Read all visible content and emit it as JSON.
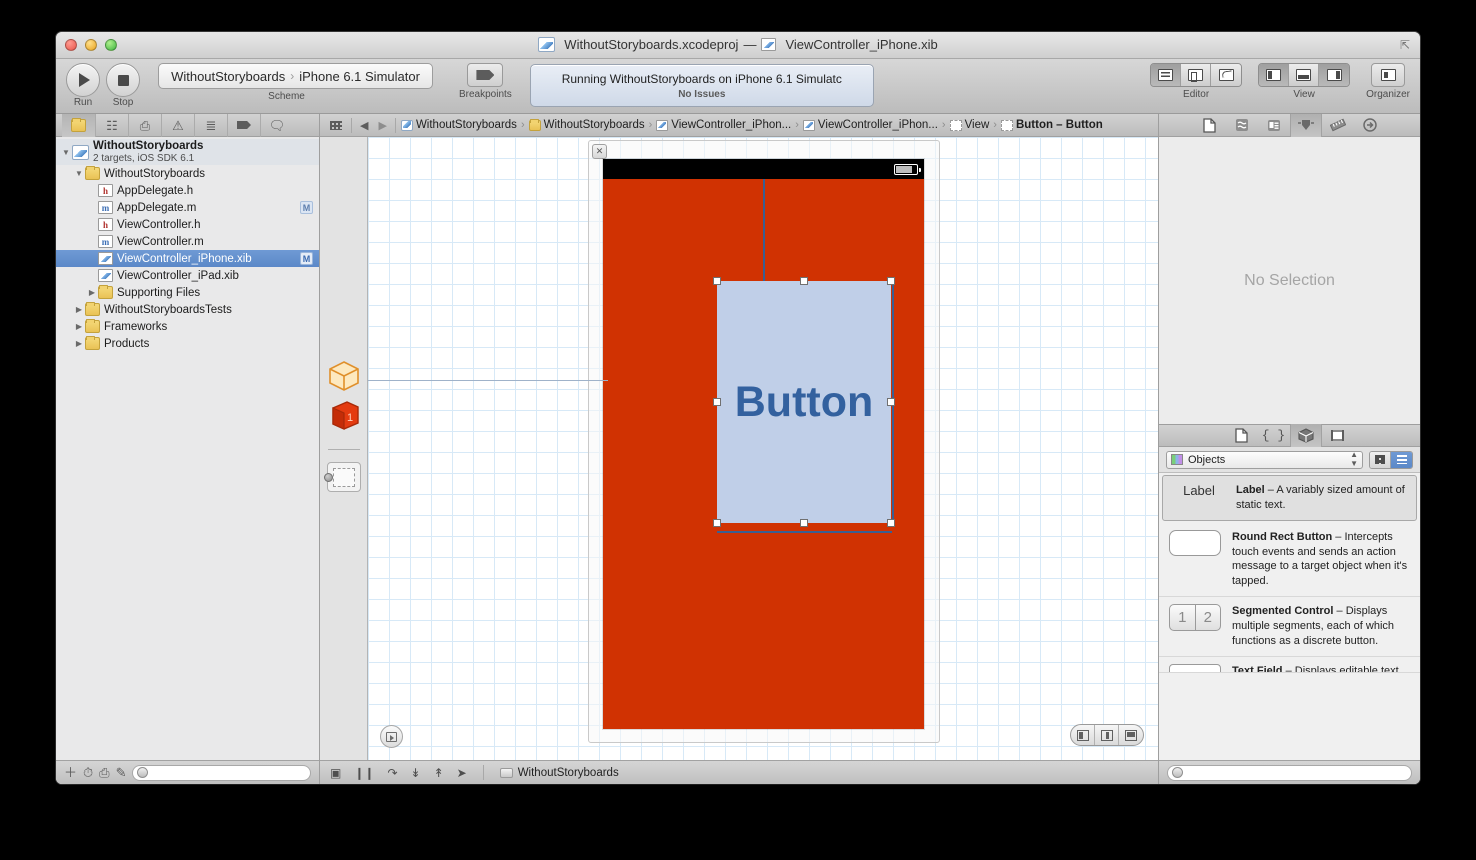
{
  "window": {
    "title_project": "WithoutStoryboards.xcodeproj",
    "title_dash": "—",
    "title_file": "ViewController_iPhone.xib",
    "fullscreen_icon": "fullscreen-icon"
  },
  "toolbar": {
    "run_label": "Run",
    "stop_label": "Stop",
    "scheme_label": "Scheme",
    "scheme_project": "WithoutStoryboards",
    "scheme_sep": "›",
    "scheme_destination": "iPhone 6.1 Simulator",
    "breakpoints_label": "Breakpoints",
    "activity_main": "Running WithoutStoryboards on iPhone 6.1 Simulatc",
    "activity_sub": "No Issues",
    "editor_label": "Editor",
    "view_label": "View",
    "organizer_label": "Organizer",
    "editor_segments": [
      {
        "name": "standard-editor",
        "selected": true
      },
      {
        "name": "assistant-editor",
        "selected": false
      },
      {
        "name": "version-editor",
        "selected": false
      }
    ],
    "view_segments": [
      {
        "name": "toggle-navigator",
        "selected": true
      },
      {
        "name": "toggle-debug-area",
        "selected": false
      },
      {
        "name": "toggle-utilities",
        "selected": true
      }
    ]
  },
  "navigator": {
    "tabs": [
      {
        "name": "project-navigator",
        "glyph": "📁",
        "selected": true
      },
      {
        "name": "symbol-navigator",
        "glyph": "⚙",
        "selected": false
      },
      {
        "name": "search-navigator",
        "glyph": "⌕",
        "selected": false
      },
      {
        "name": "issue-navigator",
        "glyph": "⚠",
        "selected": false
      },
      {
        "name": "test-navigator",
        "glyph": "≣",
        "selected": false
      },
      {
        "name": "debug-navigator",
        "glyph": "▶",
        "selected": false
      },
      {
        "name": "log-navigator",
        "glyph": "💬",
        "selected": false
      }
    ],
    "project": {
      "name": "WithoutStoryboards",
      "subtitle": "2 targets, iOS SDK 6.1"
    },
    "items": [
      {
        "label": "WithoutStoryboards",
        "icon": "folder-icon",
        "indent": 1,
        "twisty": "open",
        "badge": "",
        "selected": false
      },
      {
        "label": "AppDelegate.h",
        "icon": "header-file-icon",
        "indent": 2,
        "twisty": "none",
        "badge": "",
        "selected": false
      },
      {
        "label": "AppDelegate.m",
        "icon": "impl-file-icon",
        "indent": 2,
        "twisty": "none",
        "badge": "M",
        "selected": false
      },
      {
        "label": "ViewController.h",
        "icon": "header-file-icon",
        "indent": 2,
        "twisty": "none",
        "badge": "",
        "selected": false
      },
      {
        "label": "ViewController.m",
        "icon": "impl-file-icon",
        "indent": 2,
        "twisty": "none",
        "badge": "",
        "selected": false
      },
      {
        "label": "ViewController_iPhone.xib",
        "icon": "xib-file-icon",
        "indent": 2,
        "twisty": "none",
        "badge": "M",
        "selected": true
      },
      {
        "label": "ViewController_iPad.xib",
        "icon": "xib-file-icon",
        "indent": 2,
        "twisty": "none",
        "badge": "",
        "selected": false
      },
      {
        "label": "Supporting Files",
        "icon": "folder-icon",
        "indent": 2,
        "twisty": "closed",
        "badge": "",
        "selected": false
      },
      {
        "label": "WithoutStoryboardsTests",
        "icon": "folder-icon",
        "indent": 1,
        "twisty": "closed",
        "badge": "",
        "selected": false
      },
      {
        "label": "Frameworks",
        "icon": "folder-icon",
        "indent": 1,
        "twisty": "closed",
        "badge": "",
        "selected": false
      },
      {
        "label": "Products",
        "icon": "folder-icon",
        "indent": 1,
        "twisty": "closed",
        "badge": "",
        "selected": false
      }
    ],
    "footer": {
      "add_icon": "plus-icon",
      "recent_icon": "clock-icon",
      "source_control_icon": "source-control-icon",
      "edit_icon": "edit-icon",
      "filter_placeholder": ""
    }
  },
  "jumpbar": {
    "grid_icon": "related-items-icon",
    "back_icon": "back-arrow-icon",
    "forward_icon": "forward-arrow-icon",
    "crumbs": [
      {
        "label": "WithoutStoryboards",
        "icon": "project-icon"
      },
      {
        "label": "WithoutStoryboards",
        "icon": "folder-icon"
      },
      {
        "label": "ViewController_iPhon...",
        "icon": "xib-file-icon"
      },
      {
        "label": "ViewController_iPhon...",
        "icon": "xib-file-icon"
      },
      {
        "label": "View",
        "icon": "view-icon"
      },
      {
        "label": "Button – Button",
        "icon": "view-icon"
      }
    ]
  },
  "inspector": {
    "tabs": [
      {
        "name": "file-inspector",
        "selected": false
      },
      {
        "name": "quick-help-inspector",
        "selected": false
      },
      {
        "name": "identity-inspector",
        "selected": false
      },
      {
        "name": "attributes-inspector",
        "selected": true
      },
      {
        "name": "size-inspector",
        "selected": false
      },
      {
        "name": "connections-inspector",
        "selected": false
      }
    ],
    "empty_text": "No Selection"
  },
  "library": {
    "tabs": [
      {
        "name": "file-template-library",
        "selected": false
      },
      {
        "name": "code-snippet-library",
        "selected": false
      },
      {
        "name": "object-library",
        "selected": true
      },
      {
        "name": "media-library",
        "selected": false
      }
    ],
    "selected_library": "Objects",
    "view_toggle": [
      {
        "name": "library-grid-view",
        "selected": false
      },
      {
        "name": "library-list-view",
        "selected": true
      }
    ],
    "items": [
      {
        "thumb": "label-thumb",
        "thumb_text": "Label",
        "title": "Label",
        "dash": " – ",
        "desc": "A variably sized amount of static text.",
        "selected": true
      },
      {
        "thumb": "round-rect-button-thumb",
        "thumb_text": "",
        "title": "Round Rect Button",
        "dash": " – ",
        "desc": "Intercepts touch events and sends an action message to a target object when it's tapped.",
        "selected": false
      },
      {
        "thumb": "segmented-control-thumb",
        "thumb_text": "1|2",
        "title": "Segmented Control",
        "dash": " – ",
        "desc": "Displays multiple segments, each of which functions as a discrete button.",
        "selected": false
      },
      {
        "thumb": "text-field-thumb",
        "thumb_text": "",
        "title": "Text Field",
        "dash": " – ",
        "desc": "Displays editable text and",
        "selected": false
      }
    ],
    "filter_placeholder": ""
  },
  "canvas": {
    "close_badge": "✕",
    "device": {
      "background_color": "#d03202",
      "status_bar_color": "#000000",
      "battery_icon": "battery-icon"
    },
    "selected_object": {
      "title": "Button",
      "fill_color": "#c0cfe8",
      "text_color": "#33619f"
    },
    "outline_button": "show-document-outline-icon",
    "layout_controls": [
      {
        "name": "align-button"
      },
      {
        "name": "pin-button"
      },
      {
        "name": "resolve-issues-button"
      }
    ]
  },
  "editor_status": {
    "icons": [
      {
        "name": "step-out-icon",
        "glyph": "▣"
      },
      {
        "name": "pause-icon",
        "glyph": "❙❙"
      },
      {
        "name": "step-over-icon",
        "glyph": "↷"
      },
      {
        "name": "step-into-icon",
        "glyph": "↓"
      },
      {
        "name": "step-out-up-icon",
        "glyph": "↑"
      },
      {
        "name": "simulate-location-icon",
        "glyph": "➤"
      }
    ],
    "process_name": "WithoutStoryboards"
  }
}
